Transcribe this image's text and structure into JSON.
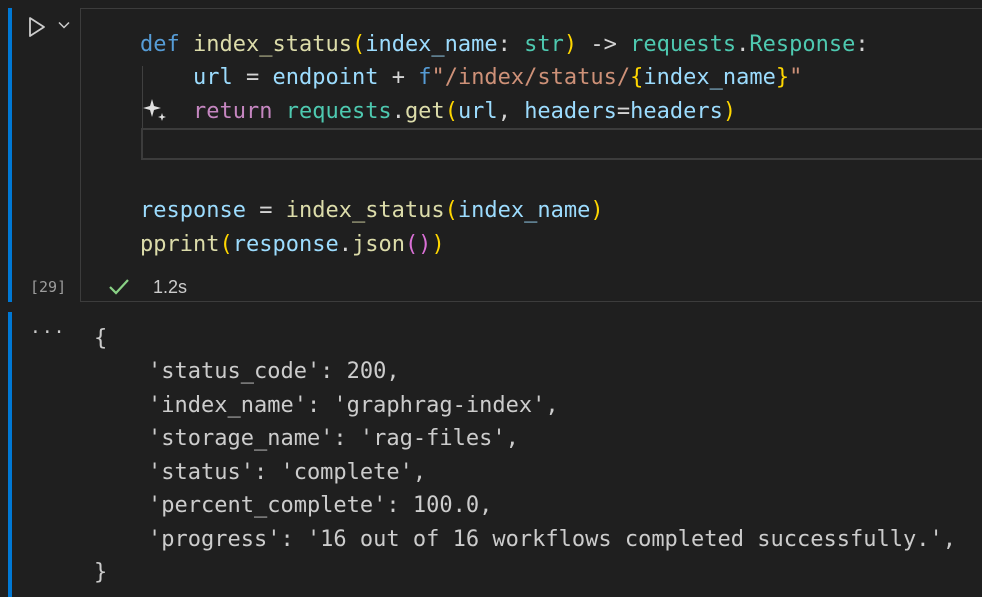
{
  "cell": {
    "execution_count": "[29]",
    "status_time": "1.2s",
    "code": {
      "line1": {
        "def": "def",
        "fn_name": "index_status",
        "open": "(",
        "param": "index_name",
        "colon": ": ",
        "type": "str",
        "close": ")",
        "arrow": " -> ",
        "module": "requests",
        "dot": ".",
        "ret_type": "Response",
        "end": ":"
      },
      "line2": {
        "var": "url",
        "eq": " = ",
        "endpoint": "endpoint",
        "plus": " + ",
        "fprefix": "f",
        "str_start": "\"/index/status/",
        "brace_open": "{",
        "interp": "index_name",
        "brace_close": "}",
        "str_end": "\""
      },
      "line3": {
        "ret": "return",
        "module": "requests",
        "dot": ".",
        "fn": "get",
        "open": "(",
        "arg1": "url",
        "comma": ", ",
        "kw": "headers",
        "eq": "=",
        "val": "headers",
        "close": ")"
      },
      "line5": {
        "var": "response",
        "eq": " = ",
        "fn": "index_status",
        "open": "(",
        "arg": "index_name",
        "close": ")"
      },
      "line6": {
        "fn": "pprint",
        "open": "(",
        "obj": "response",
        "dot": ".",
        "method": "json",
        "inner": "()",
        "close": ")"
      }
    }
  },
  "output": {
    "more_label": "···",
    "open_brace": "{",
    "close_brace": "}",
    "lines": [
      "'status_code': 200,",
      "'index_name': 'graphrag-index',",
      "'storage_name': 'rag-files',",
      "'status': 'complete',",
      "'percent_complete': 100.0,",
      "'progress': '16 out of 16 workflows completed successfully.',"
    ]
  },
  "colors": {
    "background": "#1f1f1f",
    "accent": "#0078d4",
    "success": "#89d185"
  }
}
